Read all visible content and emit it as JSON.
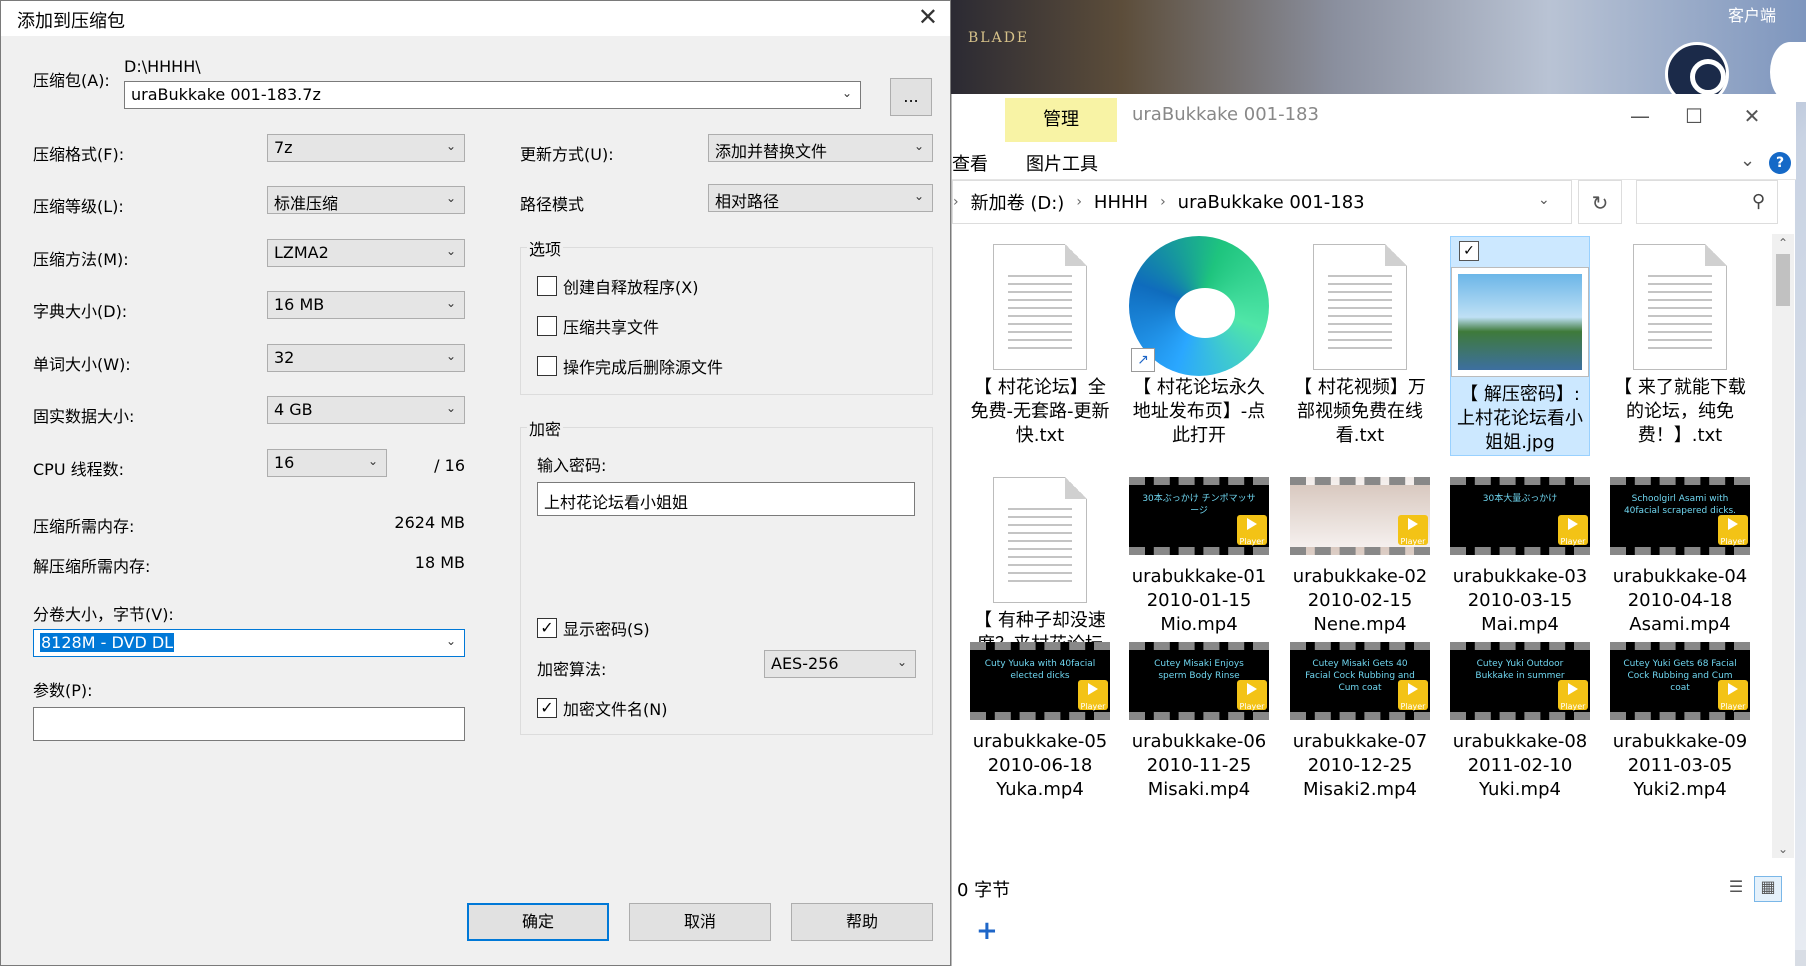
{
  "desktop": {
    "corner_label": "客户端",
    "art_text": "BLADE"
  },
  "explorer": {
    "manage_tab": "管理",
    "window_title": "uraBukkake 001-183",
    "ribbon": {
      "view_tab": "查看",
      "picture_tools_tab": "图片工具"
    },
    "address": {
      "crumbs": [
        "新加卷 (D:)",
        "HHHH",
        "uraBukkake 001-183"
      ]
    },
    "files": [
      {
        "type": "txt",
        "name": "【 村花论坛】全免费-无套路-更新快.txt"
      },
      {
        "type": "edge",
        "name": "【 村花论坛永久地址发布页】-点此打开"
      },
      {
        "type": "txt",
        "name": "【 村花视频】万部视频免费在线看.txt"
      },
      {
        "type": "jpg",
        "name": "【 解压密码】: 上村花论坛看小姐姐.jpg",
        "selected": true
      },
      {
        "type": "txt",
        "name": "【 来了就能下载的论坛，纯免费！】.txt"
      },
      {
        "type": "txt",
        "name": "【 有种子却没速度？来村花论坛人工加速】.txt"
      },
      {
        "type": "mp4",
        "name": "urabukkake-01 2010-01-15 Mio.mp4",
        "thumb": "30本ぶっかけ チンポマッサージ"
      },
      {
        "type": "mp4",
        "name": "urabukkake-02 2010-02-15 Nene.mp4",
        "thumb": "",
        "light": true
      },
      {
        "type": "mp4",
        "name": "urabukkake-03 2010-03-15 Mai.mp4",
        "thumb": "30本大量ぶっかけ"
      },
      {
        "type": "mp4",
        "name": "urabukkake-04 2010-04-18 Asami.mp4",
        "thumb": "Schoolgirl Asami with 40facial scrapered dicks."
      },
      {
        "type": "mp4",
        "name": "urabukkake-05 2010-06-18 Yuka.mp4",
        "thumb": "Cuty Yuuka with 40facial elected dicks"
      },
      {
        "type": "mp4",
        "name": "urabukkake-06 2010-11-25 Misaki.mp4",
        "thumb": "Cutey Misaki Enjoys sperm Body Rinse"
      },
      {
        "type": "mp4",
        "name": "urabukkake-07 2010-12-25 Misaki2.mp4",
        "thumb": "Cutey Misaki Gets 40 Facial Cock Rubbing and Cum coat"
      },
      {
        "type": "mp4",
        "name": "urabukkake-08 2011-02-10 Yuki.mp4",
        "thumb": "Cutey Yuki Outdoor Bukkake in summer"
      },
      {
        "type": "mp4",
        "name": "urabukkake-09 2011-03-05 Yuki2.mp4",
        "thumb": "Cutey Yuki Gets 68 Facial Cock Rubbing and Cum coat"
      }
    ],
    "status": "0 字节",
    "player_label": "Player"
  },
  "dialog": {
    "title": "添加到压缩包",
    "archive_label": "压缩包(A):",
    "archive_dir": "D:\\HHHH\\",
    "archive_name": "uraBukkake 001-183.7z",
    "browse_label": "...",
    "format_label": "压缩格式(F):",
    "format_value": "7z",
    "level_label": "压缩等级(L):",
    "level_value": "标准压缩",
    "method_label": "压缩方法(M):",
    "method_value": "LZMA2",
    "dict_label": "字典大小(D):",
    "dict_value": "16 MB",
    "word_label": "单词大小(W):",
    "word_value": "32",
    "solid_label": "固实数据大小:",
    "solid_value": "4 GB",
    "cpu_label": "CPU 线程数:",
    "cpu_value": "16",
    "cpu_max": "/ 16",
    "mem_compress_label": "压缩所需内存:",
    "mem_compress_value": "2624 MB",
    "mem_decompress_label": "解压缩所需内存:",
    "mem_decompress_value": "18 MB",
    "split_label": "分卷大小，字节(V):",
    "split_value": "8128M - DVD DL",
    "params_label": "参数(P):",
    "params_value": "",
    "update_label": "更新方式(U):",
    "update_value": "添加并替换文件",
    "path_label": "路径模式",
    "path_value": "相对路径",
    "options_title": "选项",
    "opt_sfx": "创建自释放程序(X)",
    "opt_shared": "压缩共享文件",
    "opt_delete": "操作完成后删除源文件",
    "encrypt_title": "加密",
    "password_label": "输入密码:",
    "password_value": "上村花论坛看小姐姐",
    "show_password": "显示密码(S)",
    "enc_method_label": "加密算法:",
    "enc_method_value": "AES-256",
    "encrypt_names": "加密文件名(N)",
    "ok": "确定",
    "cancel": "取消",
    "help": "帮助"
  }
}
